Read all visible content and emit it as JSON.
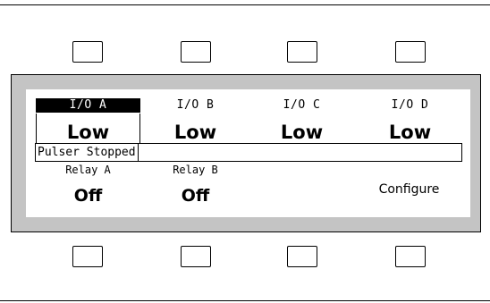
{
  "softkeys_top": [
    {
      "name": "softkey-top-1"
    },
    {
      "name": "softkey-top-2"
    },
    {
      "name": "softkey-top-3"
    },
    {
      "name": "softkey-top-4"
    }
  ],
  "softkeys_bottom": [
    {
      "name": "softkey-bottom-1"
    },
    {
      "name": "softkey-bottom-2"
    },
    {
      "name": "softkey-bottom-3"
    },
    {
      "name": "softkey-bottom-4"
    }
  ],
  "display": {
    "io": [
      {
        "label": "I/O A",
        "value": "Low",
        "selected": true
      },
      {
        "label": "I/O B",
        "value": "Low",
        "selected": false
      },
      {
        "label": "I/O C",
        "value": "Low",
        "selected": false
      },
      {
        "label": "I/O D",
        "value": "Low",
        "selected": false
      }
    ],
    "pulser_status": "Pulser Stopped",
    "relays": [
      {
        "label": "Relay A",
        "value": "Off"
      },
      {
        "label": "Relay B",
        "value": "Off"
      }
    ],
    "configure_label": "Configure"
  },
  "colors": {
    "bezel": "#c4c4c4",
    "screen": "#ffffff",
    "selected_bg": "#000000",
    "selected_fg": "#ffffff"
  }
}
